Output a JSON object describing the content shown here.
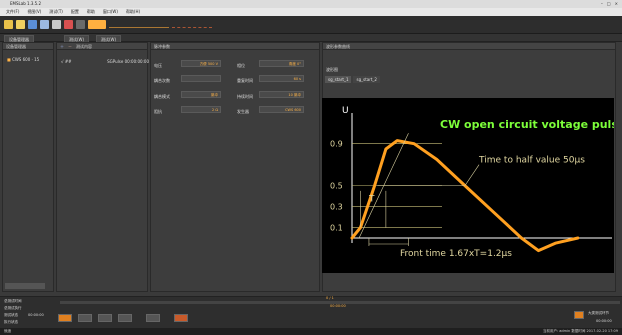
{
  "app": {
    "title": "EMSLab 1.3.5.2"
  },
  "menu": [
    "文件(F)",
    "视图(V)",
    "测试(T)",
    "配置",
    "帮助",
    "窗口(W)",
    "帮助(H)"
  ],
  "tabs": {
    "left_panel_tab": "设备管理器",
    "test_tabs": [
      "测试(W)",
      "测试(W)"
    ]
  },
  "device_panel": {
    "header": "设备管理器",
    "item": "CWS 600 · 15"
  },
  "test_panel": {
    "header": "测试内容",
    "row_code": "√ ##",
    "row_name": "SGPulse 00:00:00:00"
  },
  "params_panel": {
    "header": "脉冲参数",
    "rows": [
      {
        "l1": "电压",
        "v1a": "方便",
        "v1b": "500 V",
        "l2": "相位",
        "v2a": "角度",
        "v2b": "0°"
      },
      {
        "l1": "耦合次数",
        "v1a": "",
        "v1b": "",
        "l2": "重复时间",
        "v2a": "",
        "v2b": "60 s"
      },
      {
        "l1": "耦合模式",
        "v1a": "",
        "v1b": "脉冲",
        "l2": "持续时间",
        "v2a": "",
        "v2b": "10 脉冲"
      },
      {
        "l1": "阻抗",
        "v1a": "",
        "v1b": "2 Ω",
        "l2": "发生器",
        "v2a": "",
        "v2b": "CWS 600"
      }
    ]
  },
  "waveform_panel": {
    "header": "波形参数曲线",
    "sub_header": "波形图",
    "tabs": [
      "sg_start_1",
      "sg_start_2"
    ]
  },
  "chart_data": {
    "type": "line",
    "title": "CW open circuit voltage pulse",
    "xlabel": "t",
    "ylabel": "U",
    "y_ticks": [
      "0.1",
      "0.3",
      "0.5",
      "0.9"
    ],
    "annotations": {
      "half_value": "Time to half value 50μs",
      "front_time": "Front time 1.67xT=1.2μs",
      "t_label": "T"
    },
    "series": [
      {
        "x": [
          0,
          0.3,
          0.8,
          1.2,
          1.6,
          2.2,
          3.0,
          4.0,
          5.0,
          6.0,
          6.6,
          7.2,
          8.0
        ],
        "values": [
          0.0,
          0.1,
          0.5,
          0.85,
          0.93,
          0.9,
          0.75,
          0.5,
          0.25,
          0.0,
          -0.12,
          -0.05,
          0.0
        ]
      }
    ],
    "colors": {
      "title": "#7dff3a",
      "curve": "#ffa020",
      "axis": "#ffffff",
      "text": "#e0d6a0"
    }
  },
  "bottom": {
    "rows": [
      "总测试时间",
      "总测试执行",
      "测试状态",
      "执行状态"
    ],
    "time": "00:00:00",
    "progress": "0 / 1",
    "progress2": "00:00:00",
    "status_right": "大类测试环节",
    "status_right_time": "00:00:00"
  },
  "status": {
    "left": "就绪",
    "right": "当前用户: admin  数据时间 2017-02-20 17:09"
  }
}
